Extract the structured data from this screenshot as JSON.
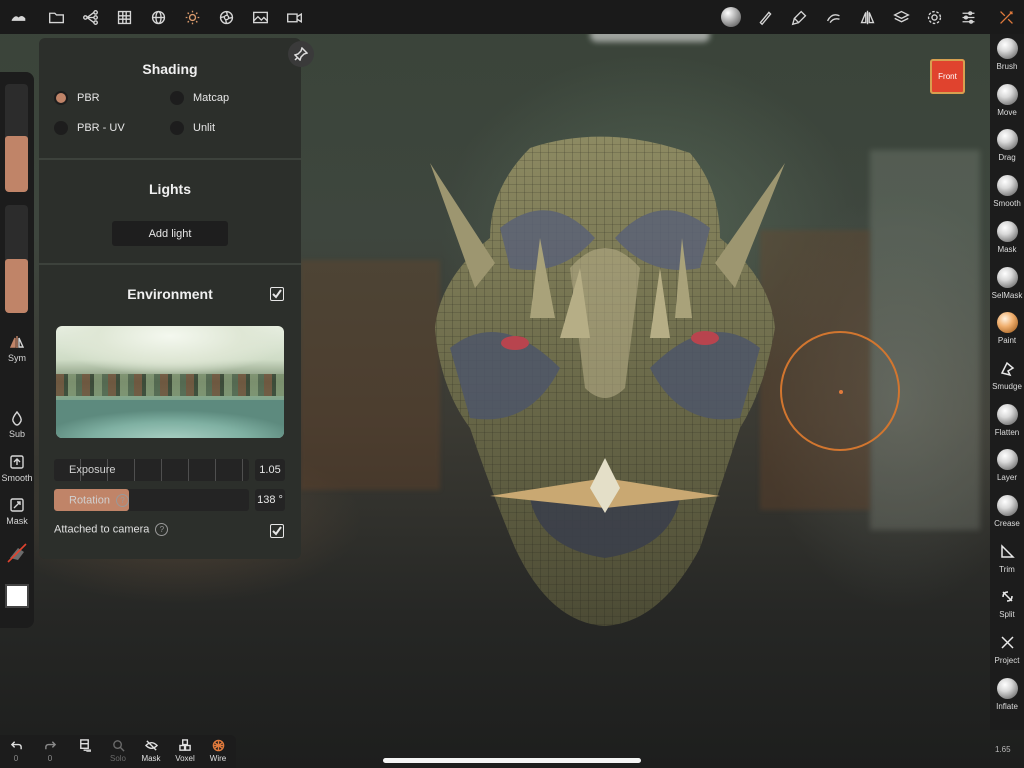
{
  "toolbar": {
    "left_icons": [
      "nomad-logo-icon",
      "folder-icon",
      "scene-tree-icon",
      "topology-icon",
      "wireframe-sphere-icon",
      "lighting-icon",
      "postprocess-icon",
      "background-image-icon",
      "video-icon"
    ],
    "right_icons": [
      "matcap-ball-icon",
      "brush-stroke-icon",
      "paint-icon",
      "material-icon",
      "symmetry-icon",
      "layers-icon",
      "settings-icon",
      "sliders-icon",
      "tools-icon"
    ]
  },
  "shading": {
    "title": "Shading",
    "options": [
      {
        "label": "PBR",
        "selected": true
      },
      {
        "label": "Matcap",
        "selected": false
      },
      {
        "label": "PBR - UV",
        "selected": false
      },
      {
        "label": "Unlit",
        "selected": false
      }
    ]
  },
  "lights": {
    "title": "Lights",
    "add_label": "Add light"
  },
  "environment": {
    "title": "Environment",
    "enabled": true,
    "exposure_label": "Exposure",
    "exposure_value": "1.05",
    "rotation_label": "Rotation",
    "rotation_value": "138 °",
    "rotation_fraction": 0.383,
    "attached_label": "Attached to camera",
    "attached_checked": true,
    "help_glyph": "?"
  },
  "left_strip": {
    "sym_label": "Sym",
    "sub_label": "Sub",
    "smooth_label": "Smooth",
    "mask_label": "Mask",
    "radius_fraction": 0.52,
    "intensity_fraction": 0.5,
    "color": "#ffffff"
  },
  "view": {
    "front_label": "Front"
  },
  "right_tools": [
    {
      "label": "Brush",
      "icon": "ball"
    },
    {
      "label": "Move",
      "icon": "ball"
    },
    {
      "label": "Drag",
      "icon": "ball"
    },
    {
      "label": "Smooth",
      "icon": "ball"
    },
    {
      "label": "Mask",
      "icon": "ball"
    },
    {
      "label": "SelMask",
      "icon": "ball"
    },
    {
      "label": "Paint",
      "icon": "orange-ball"
    },
    {
      "label": "Smudge",
      "icon": "smudge"
    },
    {
      "label": "Flatten",
      "icon": "ball"
    },
    {
      "label": "Layer",
      "icon": "ball"
    },
    {
      "label": "Crease",
      "icon": "ball"
    },
    {
      "label": "Trim",
      "icon": "trim"
    },
    {
      "label": "Split",
      "icon": "split"
    },
    {
      "label": "Project",
      "icon": "project"
    },
    {
      "label": "Inflate",
      "icon": "ball"
    }
  ],
  "version": "1.65",
  "bottom": {
    "undo_count": "0",
    "redo_count": "0",
    "solo_label": "Solo",
    "mask_label": "Mask",
    "voxel_label": "Voxel",
    "wire_label": "Wire"
  },
  "colors": {
    "accent": "#c08468",
    "panel_bg": "#2c2f2b",
    "toolbar_bg": "#1a1a1a",
    "front_badge": "#e0432e",
    "brush_cursor": "#d2762f"
  }
}
